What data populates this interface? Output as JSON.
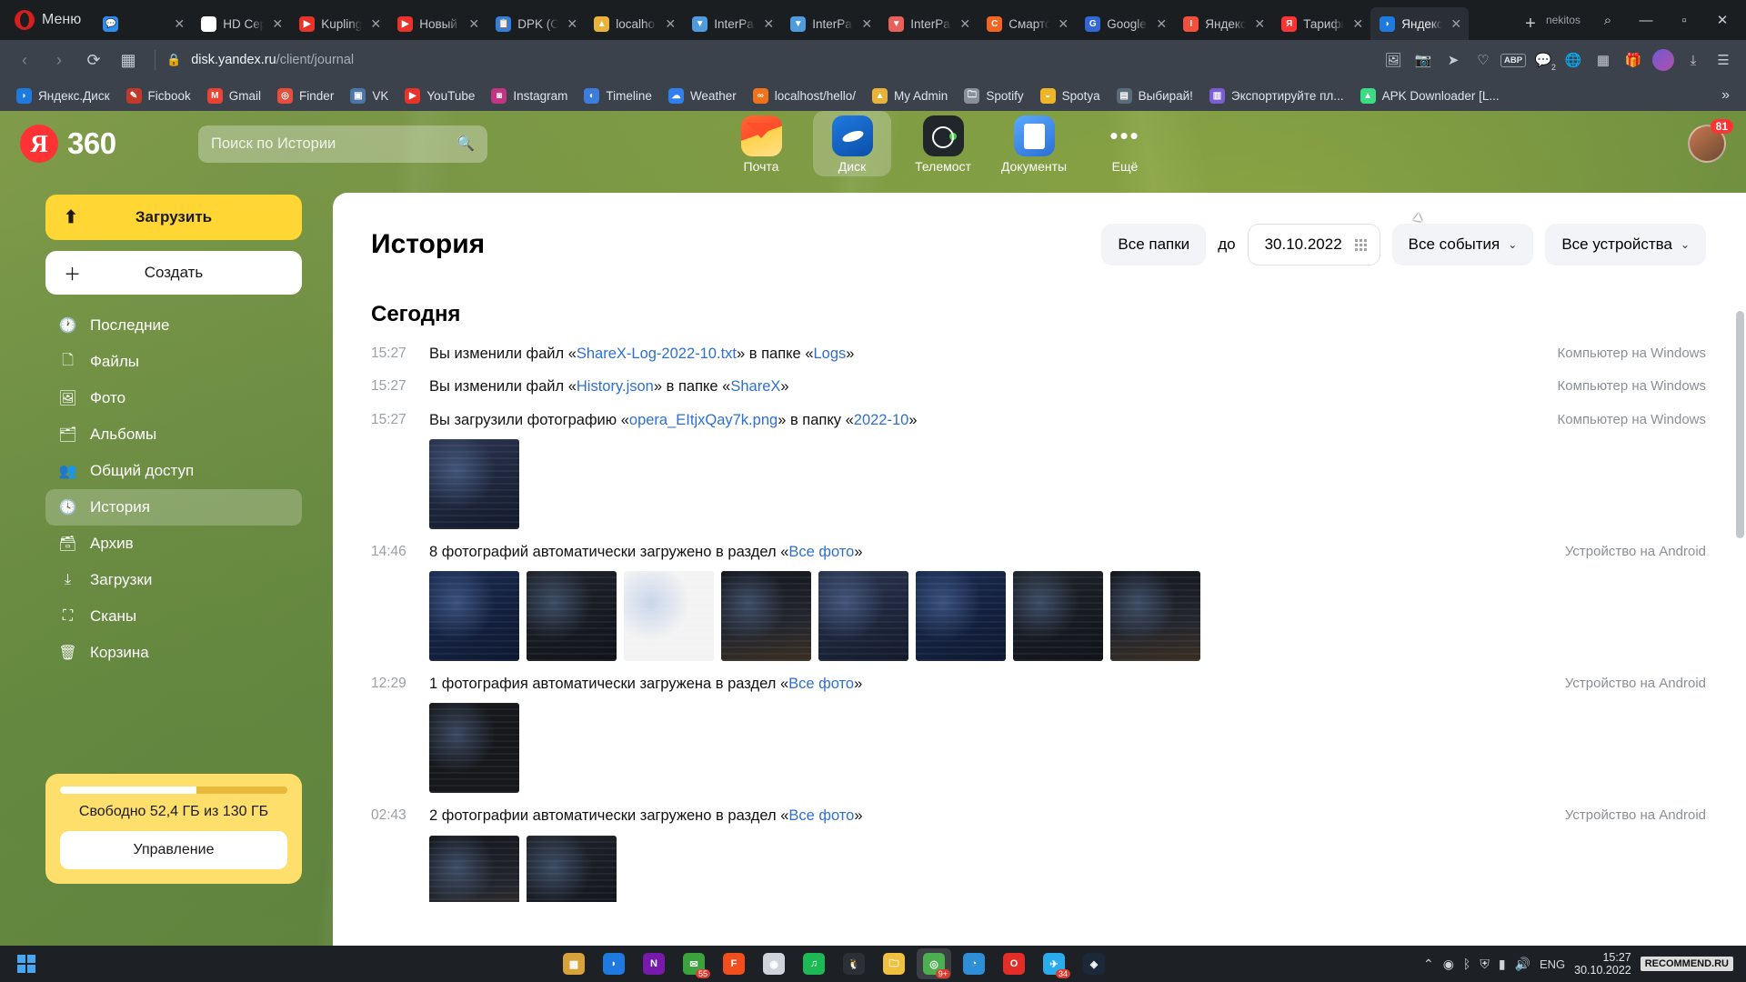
{
  "browser": {
    "menu_label": "Меню",
    "user_label": "nekitos",
    "tabs": [
      {
        "label": "",
        "icon": "messenger-icon",
        "color": "#2d8cf0",
        "glyph": "💬",
        "active": false
      },
      {
        "label": "HD Сериал",
        "icon": "hd-icon",
        "color": "#ffffff",
        "glyph": "HD",
        "active": false
      },
      {
        "label": "Kupling",
        "icon": "youtube-icon",
        "color": "#e8322a",
        "glyph": "▶",
        "active": false
      },
      {
        "label": "Новый",
        "icon": "youtube-icon",
        "color": "#e8322a",
        "glyph": "▶",
        "active": false
      },
      {
        "label": "DPK (О",
        "icon": "clipboard-icon",
        "color": "#2f7fe0",
        "glyph": "📋",
        "active": false
      },
      {
        "label": "localho",
        "icon": "pam-icon",
        "color": "#e8b33a",
        "glyph": "▲",
        "active": false
      },
      {
        "label": "InterPa",
        "icon": "interpa-icon",
        "color": "#4f9bdc",
        "glyph": "▼",
        "active": false
      },
      {
        "label": "InterPa",
        "icon": "interpa-icon",
        "color": "#4f9bdc",
        "glyph": "▼",
        "active": false
      },
      {
        "label": "InterPa",
        "icon": "interpa-red-icon",
        "color": "#e8605a",
        "glyph": "▼",
        "active": false
      },
      {
        "label": "Смарто",
        "icon": "smart-icon",
        "color": "#f26522",
        "glyph": "C",
        "active": false
      },
      {
        "label": "Google",
        "icon": "google-translate-icon",
        "color": "#3367d6",
        "glyph": "G",
        "active": false
      },
      {
        "label": "Яндекс",
        "icon": "yandex-browser-icon",
        "color": "#f2503c",
        "glyph": "I",
        "active": false
      },
      {
        "label": "Тарифы",
        "icon": "yandex-icon",
        "color": "#f33",
        "glyph": "Я",
        "active": false
      },
      {
        "label": "Яндекс",
        "icon": "yandex-disk-icon",
        "color": "#1f7ae0",
        "glyph": "◗",
        "active": true
      }
    ],
    "new_tab_label": "+",
    "window_controls": {
      "search": "⌕",
      "minimize": "—",
      "maximize": "▫",
      "close": "✕"
    },
    "address": {
      "back": "‹",
      "forward": "›",
      "reload": "⟳",
      "tiles": "▦",
      "lock_icon": "lock-icon",
      "host": "disk.yandex.ru",
      "path": "/client/journal",
      "actions": [
        "picture-icon",
        "camera-icon",
        "send-icon",
        "heart-icon",
        "abp-badge",
        "messenger-icon",
        "globe-icon",
        "calc-icon",
        "gift-icon",
        "avatar",
        "download-icon",
        "menu-icon"
      ],
      "abp_label": "ABP",
      "messenger_count": "2"
    },
    "bookmarks": [
      {
        "label": "Яндекс.Диск",
        "icon": "yandex-disk-icon",
        "color": "#1f7ae0",
        "glyph": "◗"
      },
      {
        "label": "Ficbook",
        "icon": "ficbook-icon",
        "color": "#c0392b",
        "glyph": "✎"
      },
      {
        "label": "Gmail",
        "icon": "gmail-icon",
        "color": "#ea4335",
        "glyph": "M"
      },
      {
        "label": "Finder",
        "icon": "finder-icon",
        "color": "#e84c3d",
        "glyph": "◎"
      },
      {
        "label": "VK",
        "icon": "vk-icon",
        "color": "#4a76a8",
        "glyph": "▣"
      },
      {
        "label": "YouTube",
        "icon": "youtube-icon",
        "color": "#e8322a",
        "glyph": "▶"
      },
      {
        "label": "Instagram",
        "icon": "instagram-icon",
        "color": "#c13584",
        "glyph": "◙"
      },
      {
        "label": "Timeline",
        "icon": "timeline-icon",
        "color": "#3b7ddd",
        "glyph": "◐"
      },
      {
        "label": "Weather",
        "icon": "weather-icon",
        "color": "#2f80ed",
        "glyph": "☁"
      },
      {
        "label": "localhost/hello/",
        "icon": "localhost-icon",
        "color": "#f2711c",
        "glyph": "∞"
      },
      {
        "label": "My Admin",
        "icon": "pam-icon",
        "color": "#e8b33a",
        "glyph": "▲"
      },
      {
        "label": "Spotify",
        "icon": "folder-icon",
        "color": "#8a9099",
        "glyph": "🗀"
      },
      {
        "label": "Spotya",
        "icon": "spotya-icon",
        "color": "#f0b429",
        "glyph": "◒"
      },
      {
        "label": "Выбирай!",
        "icon": "choose-icon",
        "color": "#5a6b7a",
        "glyph": "▤"
      },
      {
        "label": "Экспортируйте пл...",
        "icon": "export-icon",
        "color": "#7b5ed6",
        "glyph": "▥"
      },
      {
        "label": "APK Downloader [L...",
        "icon": "apk-icon",
        "color": "#3ddc84",
        "glyph": "▲"
      }
    ],
    "bookmarks_more": "»"
  },
  "app": {
    "brand": {
      "mark": "Я",
      "name": "360"
    },
    "search": {
      "placeholder": "Поиск по Истории",
      "value": "",
      "icon": "search-icon"
    },
    "services": [
      {
        "label": "Почта",
        "icon": "mail-icon",
        "active": false
      },
      {
        "label": "Диск",
        "icon": "disk-icon",
        "active": true
      },
      {
        "label": "Телемост",
        "icon": "telemost-icon",
        "active": false
      },
      {
        "label": "Документы",
        "icon": "documents-icon",
        "active": false
      },
      {
        "label": "Ещё",
        "icon": "more-icon",
        "active": false
      }
    ],
    "notifications_count": "81"
  },
  "sidebar": {
    "upload_label": "Загрузить",
    "upload_icon": "upload-icon",
    "create_label": "Создать",
    "create_icon": "plus-icon",
    "items": [
      {
        "label": "Последние",
        "icon": "clock-icon",
        "active": false
      },
      {
        "label": "Файлы",
        "icon": "file-icon",
        "active": false
      },
      {
        "label": "Фото",
        "icon": "photo-icon",
        "active": false
      },
      {
        "label": "Альбомы",
        "icon": "albums-icon",
        "active": false
      },
      {
        "label": "Общий доступ",
        "icon": "people-icon",
        "active": false
      },
      {
        "label": "История",
        "icon": "history-icon",
        "active": true
      },
      {
        "label": "Архив",
        "icon": "archive-icon",
        "active": false
      },
      {
        "label": "Загрузки",
        "icon": "download-icon",
        "active": false
      },
      {
        "label": "Сканы",
        "icon": "scan-icon",
        "active": false
      },
      {
        "label": "Корзина",
        "icon": "trash-icon",
        "active": false
      }
    ],
    "storage": {
      "text": "Свободно 52,4 ГБ из 130 ГБ",
      "free_percent": "60",
      "manage_label": "Управление"
    }
  },
  "main": {
    "title": "История",
    "filters": {
      "all_folders": "Все папки",
      "до": "до",
      "date_value": "30.10.2022",
      "date_icon": "calendar-icon",
      "all_events": "Все события",
      "all_devices": "Все устройства",
      "chevron": "⌄"
    },
    "day_label": "Сегодня",
    "events": [
      {
        "time": "15:27",
        "parts": [
          {
            "t": "Вы изменили файл «",
            "link": false
          },
          {
            "t": "ShareX-Log-2022-10.txt",
            "link": true
          },
          {
            "t": "» в папке «",
            "link": false
          },
          {
            "t": "Logs",
            "link": true
          },
          {
            "t": "»",
            "link": false
          }
        ],
        "device": "Компьютер на Windows",
        "thumbs": []
      },
      {
        "time": "15:27",
        "parts": [
          {
            "t": "Вы изменили файл «",
            "link": false
          },
          {
            "t": "History.json",
            "link": true
          },
          {
            "t": "» в папке «",
            "link": false
          },
          {
            "t": "ShareX",
            "link": true
          },
          {
            "t": "»",
            "link": false
          }
        ],
        "device": "Компьютер на Windows",
        "thumbs": []
      },
      {
        "time": "15:27",
        "parts": [
          {
            "t": "Вы загрузили фотографию «",
            "link": false
          },
          {
            "t": "opera_EItjxQay7k.png",
            "link": true
          },
          {
            "t": "» в папку «",
            "link": false
          },
          {
            "t": "2022-10",
            "link": true
          },
          {
            "t": "»",
            "link": false
          }
        ],
        "device": "Компьютер на Windows",
        "thumbs": [
          "t-win"
        ]
      },
      {
        "time": "14:46",
        "parts": [
          {
            "t": "8 фотографий автоматически загружено в раздел «",
            "link": false
          },
          {
            "t": "Все фото",
            "link": true
          },
          {
            "t": "»",
            "link": false
          }
        ],
        "device": "Устройство на Android",
        "thumbs": [
          "t-blue",
          "t-dark",
          "t-white",
          "t-night",
          "t-win",
          "t-blue",
          "t-dark",
          "t-night"
        ]
      },
      {
        "time": "12:29",
        "parts": [
          {
            "t": "1 фотография автоматически загружена в раздел «",
            "link": false
          },
          {
            "t": "Все фото",
            "link": true
          },
          {
            "t": "»",
            "link": false
          }
        ],
        "device": "Устройство на Android",
        "thumbs": [
          "t-chat"
        ]
      },
      {
        "time": "02:43",
        "parts": [
          {
            "t": "2 фотографии автоматически загружено в раздел «",
            "link": false
          },
          {
            "t": "Все фото",
            "link": true
          },
          {
            "t": "»",
            "link": false
          }
        ],
        "device": "Устройство на Android",
        "thumbs": [
          "t-night",
          "t-dark"
        ]
      }
    ]
  },
  "taskbar": {
    "start_icon": "windows-icon",
    "apps": [
      {
        "icon": "calculator-icon",
        "color": "#d8a13a",
        "glyph": "▦",
        "badge": "",
        "active": false
      },
      {
        "icon": "yandex-disk-icon",
        "color": "#1f7ae0",
        "glyph": "◗",
        "badge": "",
        "active": false
      },
      {
        "icon": "onenote-icon",
        "color": "#7719aa",
        "glyph": "N",
        "badge": "",
        "active": false
      },
      {
        "icon": "mail-icon",
        "color": "#3ba33b",
        "glyph": "✉",
        "badge": "55",
        "active": false
      },
      {
        "icon": "figma-icon",
        "color": "#f24e1e",
        "glyph": "F",
        "badge": "",
        "active": false
      },
      {
        "icon": "disc-icon",
        "color": "#cfd4da",
        "glyph": "◉",
        "badge": "",
        "active": false
      },
      {
        "icon": "spotify-icon",
        "color": "#1db954",
        "glyph": "♫",
        "badge": "",
        "active": false
      },
      {
        "icon": "penguin-icon",
        "color": "#2b2f36",
        "glyph": "🐧",
        "badge": "",
        "active": false
      },
      {
        "icon": "explorer-icon",
        "color": "#f0c040",
        "glyph": "🗀",
        "badge": "",
        "active": false
      },
      {
        "icon": "chrome-icon",
        "color": "#4caf50",
        "glyph": "◎",
        "badge": "9+",
        "active": true
      },
      {
        "icon": "edge-icon",
        "color": "#2f8fd6",
        "glyph": "◔",
        "badge": "",
        "active": false
      },
      {
        "icon": "opera-icon",
        "color": "#e52d27",
        "glyph": "O",
        "badge": "",
        "active": false
      },
      {
        "icon": "telegram-icon",
        "color": "#2aabee",
        "glyph": "✈",
        "badge": "34",
        "active": false
      },
      {
        "icon": "steam-icon",
        "color": "#1b2838",
        "glyph": "◈",
        "badge": "",
        "active": false
      }
    ],
    "tray": {
      "chevron": "⌃",
      "icons": [
        "antivirus-icon",
        "bluetooth-icon",
        "shield-icon",
        "network-icon",
        "volume-icon"
      ],
      "lang": "ENG",
      "time": "15:27",
      "date": "30.10.2022",
      "watermark": "RECOMMEND.RU"
    }
  }
}
